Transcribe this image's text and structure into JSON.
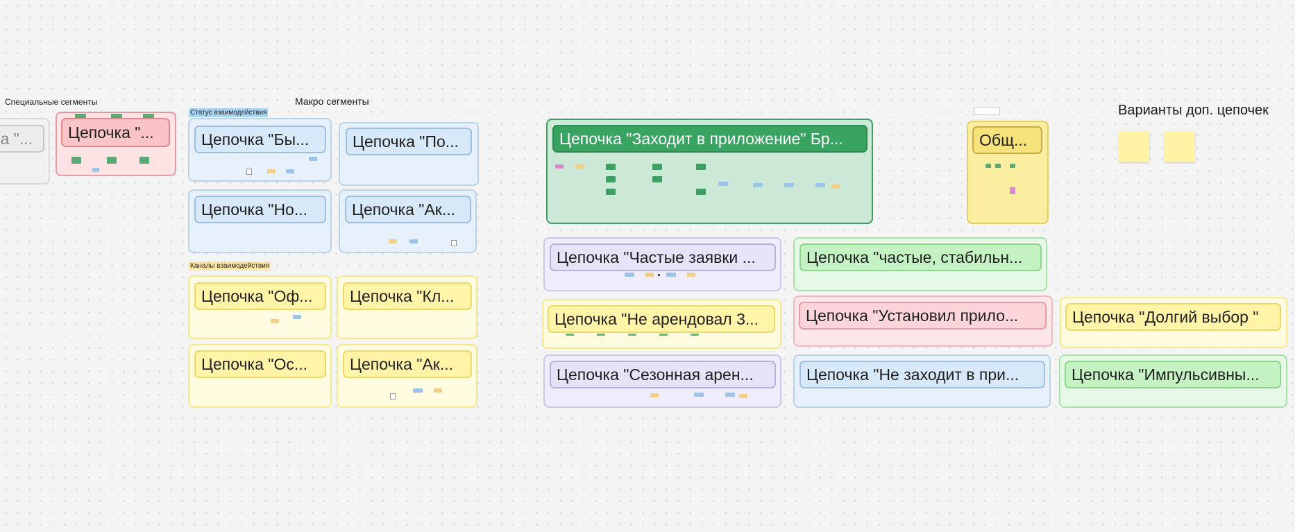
{
  "labels": {
    "special_segments": "Специальные сегменты",
    "macro_segments": "Макро сегменты",
    "status_tag": "Статус взаимодействия",
    "channels_tag": "Каналы взаимодействия",
    "variants_title": "Варианты доп. цепочек"
  },
  "chains": {
    "c0": "ка \"...",
    "c1": "Цепочка \"...",
    "c2": "Цепочка \"Бы...",
    "c3": "Цепочка \"По...",
    "c4": "Цепочка \"Но...",
    "c5": "Цепочка \"Ак...",
    "c6": "Цепочка \"Оф...",
    "c7": "Цепочка \"Кл...",
    "c8": "Цепочка \"Ос...",
    "c9": "Цепочка \"Ак...",
    "c10": "Цепочка \"Заходит в приложение\" Бр...",
    "c11": "Общ...",
    "c12": "Цепочка \"Частые заявки ...",
    "c13": "Цепочка \"частые, стабильн...",
    "c14": "Цепочка \"Не арендовал 3...",
    "c15": "Цепочка \"Установил прило...",
    "c16": "Цепочка \"Долгий выбор \"",
    "c17": "Цепочка \"Сезонная арен...",
    "c18": "Цепочка \"Не заходит в при...",
    "c19": "Цепочка \"Импульсивны..."
  },
  "colors": {
    "canvas": "#f4f4f4",
    "status_tag_bg": "#a9d4f2",
    "channels_tag_bg": "#fde6a8"
  }
}
